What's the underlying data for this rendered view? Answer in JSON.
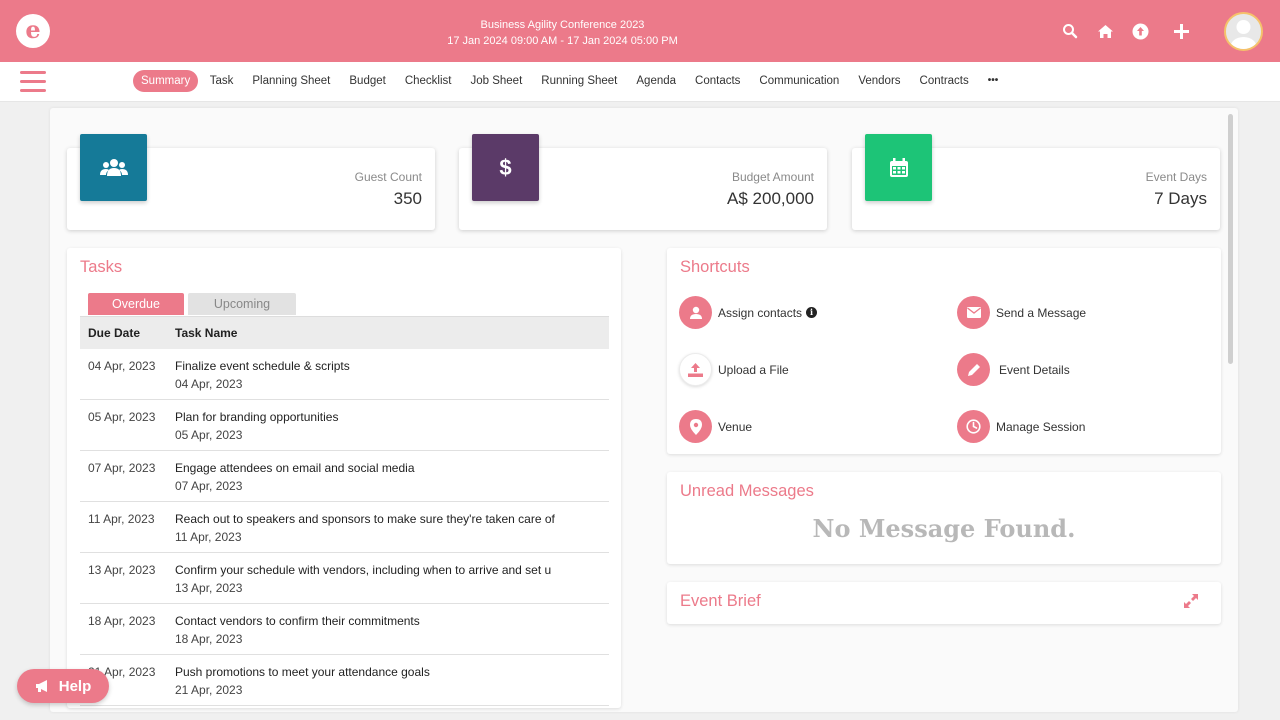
{
  "colors": {
    "brand": "#ec7a8a",
    "guest": "#157a98",
    "budget": "#5b3a68",
    "days": "#1dc477"
  },
  "header": {
    "logo_letter": "e",
    "event_name": "Business Agility Conference 2023",
    "event_dates": "17 Jan 2024 09:00 AM - 17 Jan 2024 05:00 PM",
    "icons": [
      "search-icon",
      "home-icon",
      "upload-icon",
      "plus-icon",
      "avatar"
    ]
  },
  "nav": {
    "tabs": [
      "Summary",
      "Task",
      "Planning Sheet",
      "Budget",
      "Checklist",
      "Job Sheet",
      "Running Sheet",
      "Agenda",
      "Contacts",
      "Communication",
      "Vendors",
      "Contracts"
    ],
    "more": "•••"
  },
  "stats": [
    {
      "label": "Guest Count",
      "value": "350",
      "icon": "users-icon"
    },
    {
      "label": "Budget Amount",
      "value": "A$ 200,000",
      "icon": "dollar-icon"
    },
    {
      "label": "Event Days",
      "value": "7 Days",
      "icon": "calendar-icon"
    }
  ],
  "tasks": {
    "title": "Tasks",
    "tabs": [
      "Overdue",
      "Upcoming"
    ],
    "columns": [
      "Due Date",
      "Task Name"
    ],
    "rows": [
      {
        "date": "04 Apr, 2023",
        "name": "Finalize event schedule & scripts",
        "sub": "04 Apr, 2023"
      },
      {
        "date": "05 Apr, 2023",
        "name": "Plan for branding opportunities",
        "sub": "05 Apr, 2023"
      },
      {
        "date": "07 Apr, 2023",
        "name": "Engage attendees on email and social media",
        "sub": "07 Apr, 2023"
      },
      {
        "date": "11 Apr, 2023",
        "name": "Reach out to speakers and sponsors to make sure they're taken care of",
        "sub": "11 Apr, 2023"
      },
      {
        "date": "13 Apr, 2023",
        "name": "Confirm your schedule with vendors, including when to arrive and set u",
        "sub": "13 Apr, 2023"
      },
      {
        "date": "18 Apr, 2023",
        "name": "Contact vendors to confirm their commitments",
        "sub": "18 Apr, 2023"
      },
      {
        "date": "21 Apr, 2023",
        "name": "Push promotions to meet your attendance goals",
        "sub": "21 Apr, 2023"
      }
    ]
  },
  "shortcuts": {
    "title": "Shortcuts",
    "items": [
      {
        "label": "Assign contacts",
        "icon": "user-icon"
      },
      {
        "label": "Send a Message",
        "icon": "envelope-icon"
      },
      {
        "label": "Upload a File",
        "icon": "upload-file-icon"
      },
      {
        "label": "Event Details",
        "icon": "pencil-icon"
      },
      {
        "label": "Venue",
        "icon": "location-pin-icon"
      },
      {
        "label": "Manage Session",
        "icon": "clock-icon"
      }
    ]
  },
  "messages": {
    "title": "Unread Messages",
    "empty": "No Message Found."
  },
  "brief": {
    "title": "Event Brief"
  },
  "help": {
    "label": "Help"
  }
}
